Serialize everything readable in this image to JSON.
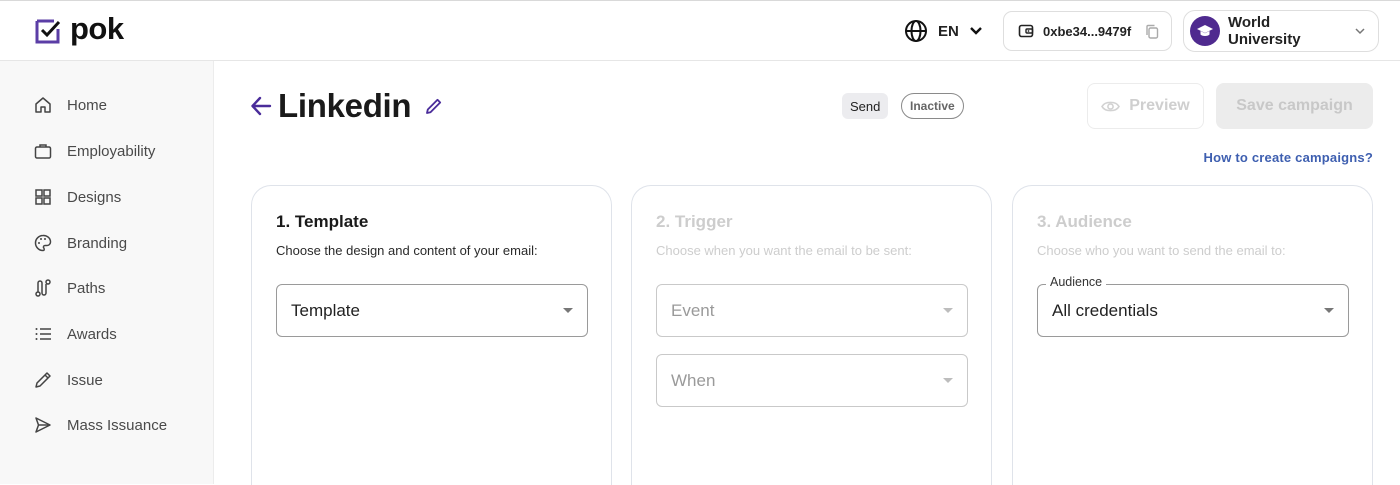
{
  "header": {
    "logo_text": "pok",
    "language": "EN",
    "wallet_address": "0xbe34...9479f",
    "org_name": "World University"
  },
  "sidebar": {
    "items": [
      {
        "label": "Home",
        "icon": "home-icon"
      },
      {
        "label": "Employability",
        "icon": "briefcase-icon"
      },
      {
        "label": "Designs",
        "icon": "grid-icon"
      },
      {
        "label": "Branding",
        "icon": "palette-icon"
      },
      {
        "label": "Paths",
        "icon": "path-icon"
      },
      {
        "label": "Awards",
        "icon": "list-icon"
      },
      {
        "label": "Issue",
        "icon": "pencil-icon"
      },
      {
        "label": "Mass Issuance",
        "icon": "send-icon"
      }
    ]
  },
  "page": {
    "title": "Linkedin",
    "badge_send": "Send",
    "badge_status": "Inactive",
    "preview_label": "Preview",
    "save_label": "Save campaign",
    "help_link": "How to create campaigns?"
  },
  "cards": {
    "template": {
      "title": "1. Template",
      "subtitle": "Choose the design and content of your email:",
      "select_value": "Template"
    },
    "trigger": {
      "title": "2. Trigger",
      "subtitle": "Choose when you want the email to be sent:",
      "event_placeholder": "Event",
      "when_placeholder": "When"
    },
    "audience": {
      "title": "3. Audience",
      "subtitle": "Choose who you want to send the email to:",
      "select_label": "Audience",
      "select_value": "All credentials"
    }
  },
  "colors": {
    "brand": "#4f2a8f",
    "link": "#3e5fb0"
  }
}
